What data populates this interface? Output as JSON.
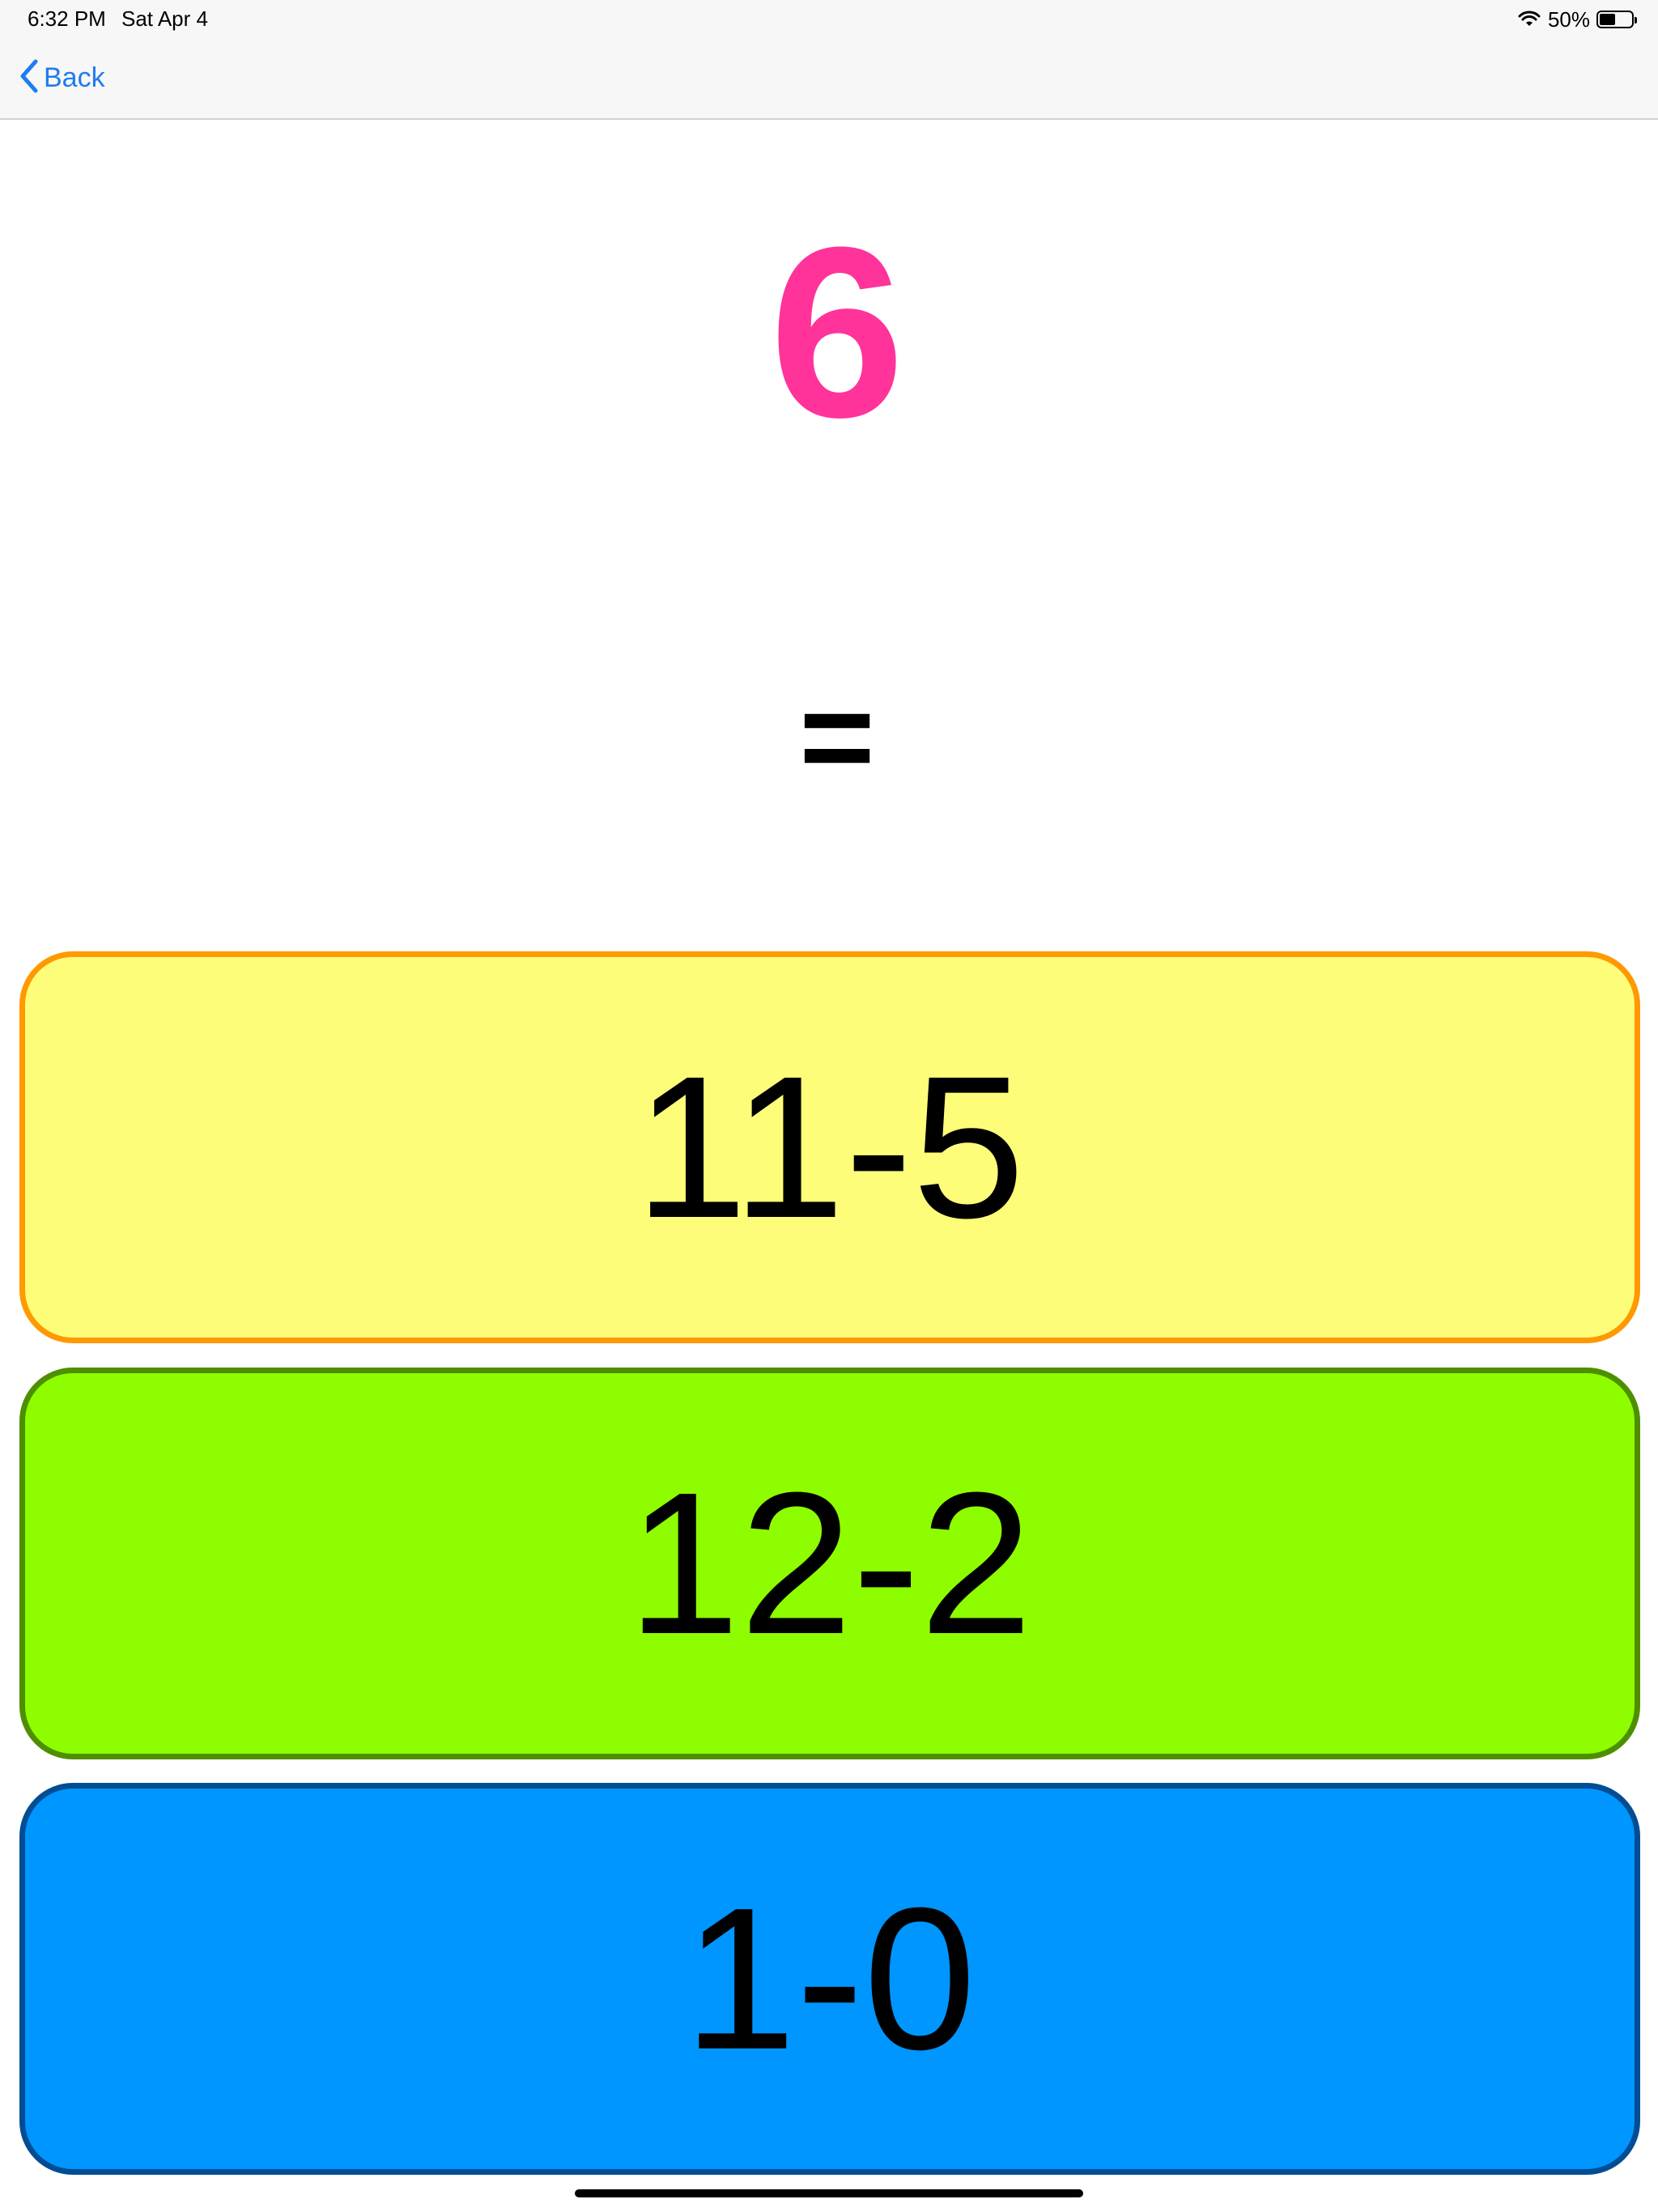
{
  "status_bar": {
    "time": "6:32 PM",
    "date": "Sat Apr 4",
    "battery_percent": "50%",
    "battery_level": 0.5,
    "icons": [
      "wifi-icon",
      "battery-icon"
    ]
  },
  "nav": {
    "back_label": "Back",
    "back_icon": "chevron-left-icon",
    "accent_color": "#1e7cf0"
  },
  "question": {
    "target": "6",
    "target_color": "#ff3399",
    "equals": "="
  },
  "options": [
    {
      "label": "11-5",
      "fill": "#fefd7a",
      "border": "#ff9900"
    },
    {
      "label": "12-2",
      "fill": "#8efd00",
      "border": "#4e8f00"
    },
    {
      "label": "1-0",
      "fill": "#0096ff",
      "border": "#004d94"
    }
  ]
}
